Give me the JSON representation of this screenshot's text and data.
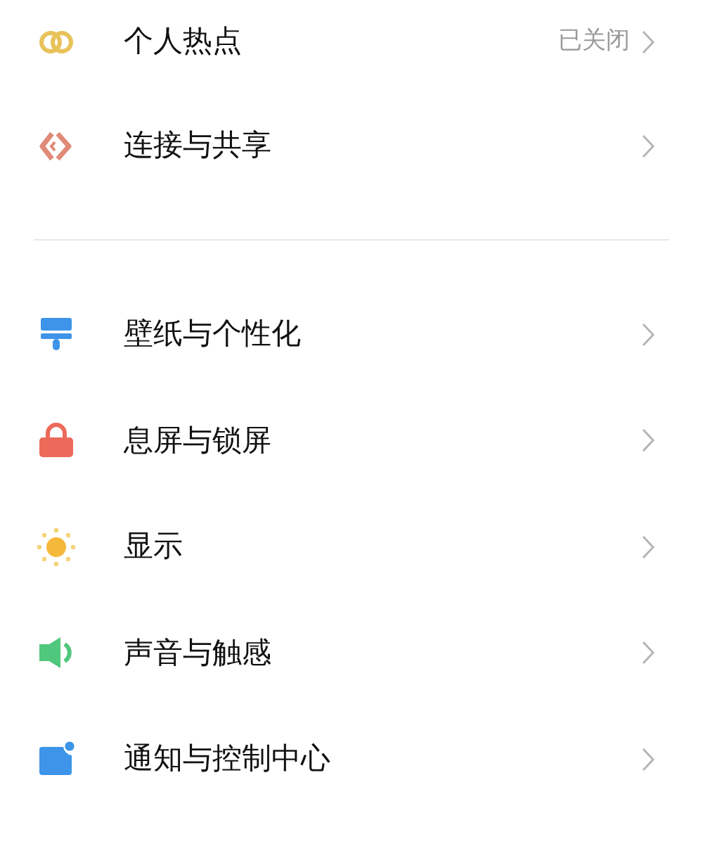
{
  "groups": [
    {
      "items": [
        {
          "label": "个人热点",
          "status": "已关闭"
        },
        {
          "label": "连接与共享"
        }
      ]
    },
    {
      "items": [
        {
          "label": "壁纸与个性化"
        },
        {
          "label": "息屏与锁屏"
        },
        {
          "label": "显示"
        },
        {
          "label": "声音与触感"
        },
        {
          "label": "通知与控制中心"
        }
      ]
    }
  ]
}
